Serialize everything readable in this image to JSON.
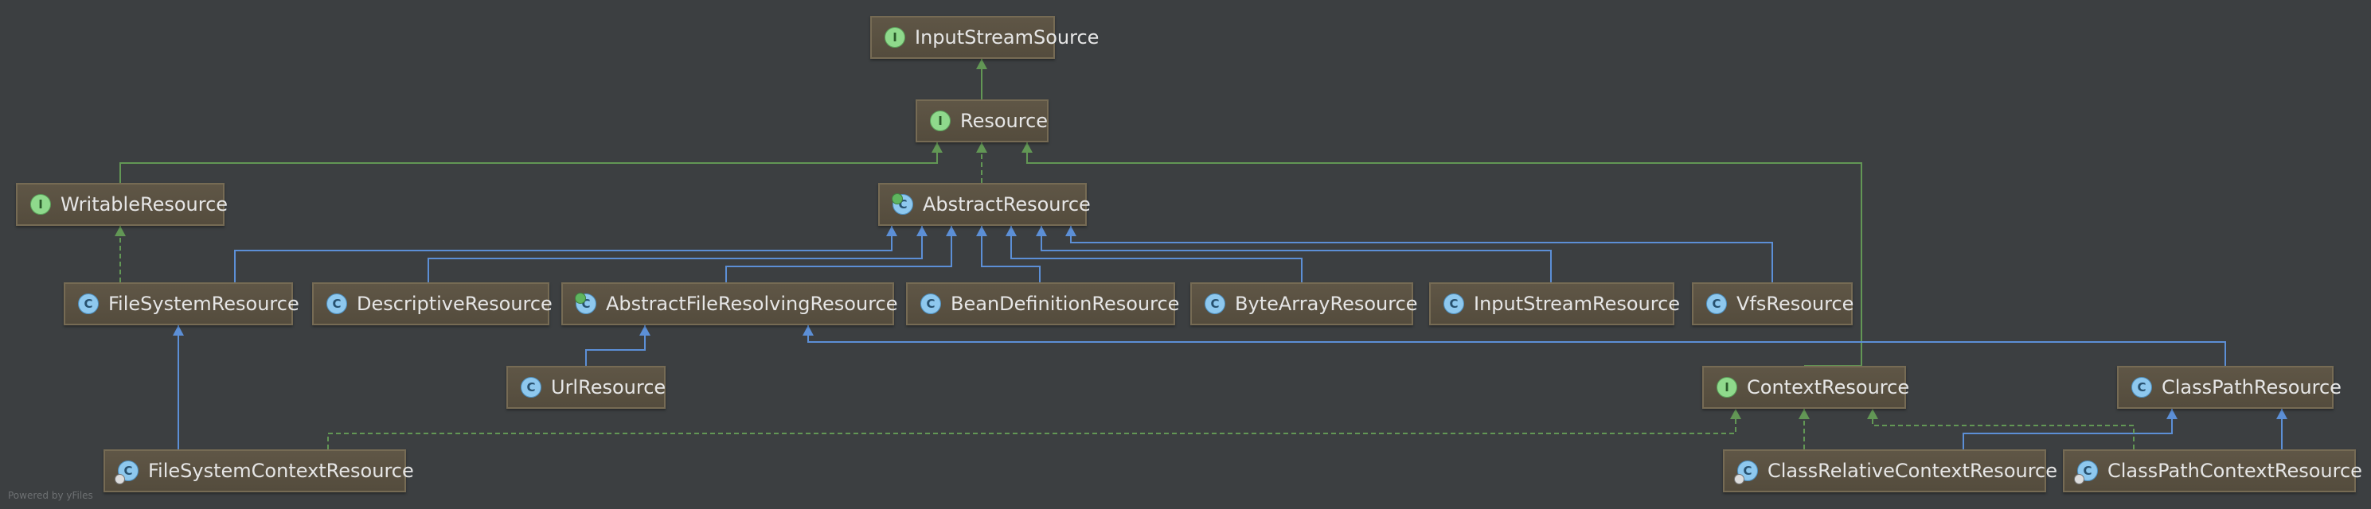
{
  "diagram": {
    "nodes": [
      {
        "id": "InputStreamSource",
        "label": "InputStreamSource",
        "kind": "interface",
        "badge": "I"
      },
      {
        "id": "Resource",
        "label": "Resource",
        "kind": "interface",
        "badge": "I"
      },
      {
        "id": "WritableResource",
        "label": "WritableResource",
        "kind": "interface",
        "badge": "I"
      },
      {
        "id": "AbstractResource",
        "label": "AbstractResource",
        "kind": "abstract",
        "badge": "C"
      },
      {
        "id": "FileSystemResource",
        "label": "FileSystemResource",
        "kind": "class",
        "badge": "C"
      },
      {
        "id": "DescriptiveResource",
        "label": "DescriptiveResource",
        "kind": "class",
        "badge": "C"
      },
      {
        "id": "AbstractFileResolvingResource",
        "label": "AbstractFileResolvingResource",
        "kind": "abstract",
        "badge": "C"
      },
      {
        "id": "BeanDefinitionResource",
        "label": "BeanDefinitionResource",
        "kind": "class",
        "badge": "C"
      },
      {
        "id": "ByteArrayResource",
        "label": "ByteArrayResource",
        "kind": "class",
        "badge": "C"
      },
      {
        "id": "InputStreamResource",
        "label": "InputStreamResource",
        "kind": "class",
        "badge": "C"
      },
      {
        "id": "VfsResource",
        "label": "VfsResource",
        "kind": "class",
        "badge": "C"
      },
      {
        "id": "UrlResource",
        "label": "UrlResource",
        "kind": "class",
        "badge": "C"
      },
      {
        "id": "ContextResource",
        "label": "ContextResource",
        "kind": "interface",
        "badge": "I"
      },
      {
        "id": "ClassPathResource",
        "label": "ClassPathResource",
        "kind": "class",
        "badge": "C"
      },
      {
        "id": "FileSystemContextResource",
        "label": "FileSystemContextResource",
        "kind": "class",
        "badge": "C",
        "pinned": true
      },
      {
        "id": "ClassRelativeContextResource",
        "label": "ClassRelativeContextResource",
        "kind": "class",
        "badge": "C",
        "pinned": true
      },
      {
        "id": "ClassPathContextResource",
        "label": "ClassPathContextResource",
        "kind": "class",
        "badge": "C",
        "pinned": true
      }
    ],
    "edges": [
      {
        "from": "Resource",
        "to": "InputStreamSource",
        "type": "extends-interface"
      },
      {
        "from": "WritableResource",
        "to": "Resource",
        "type": "extends-interface"
      },
      {
        "from": "AbstractResource",
        "to": "Resource",
        "type": "implements"
      },
      {
        "from": "ContextResource",
        "to": "Resource",
        "type": "extends-interface"
      },
      {
        "from": "FileSystemResource",
        "to": "WritableResource",
        "type": "implements"
      },
      {
        "from": "FileSystemResource",
        "to": "AbstractResource",
        "type": "extends"
      },
      {
        "from": "DescriptiveResource",
        "to": "AbstractResource",
        "type": "extends"
      },
      {
        "from": "AbstractFileResolvingResource",
        "to": "AbstractResource",
        "type": "extends"
      },
      {
        "from": "BeanDefinitionResource",
        "to": "AbstractResource",
        "type": "extends"
      },
      {
        "from": "ByteArrayResource",
        "to": "AbstractResource",
        "type": "extends"
      },
      {
        "from": "InputStreamResource",
        "to": "AbstractResource",
        "type": "extends"
      },
      {
        "from": "VfsResource",
        "to": "AbstractResource",
        "type": "extends"
      },
      {
        "from": "UrlResource",
        "to": "AbstractFileResolvingResource",
        "type": "extends"
      },
      {
        "from": "ClassPathResource",
        "to": "AbstractFileResolvingResource",
        "type": "extends"
      },
      {
        "from": "FileSystemContextResource",
        "to": "FileSystemResource",
        "type": "extends"
      },
      {
        "from": "FileSystemContextResource",
        "to": "ContextResource",
        "type": "implements"
      },
      {
        "from": "ClassRelativeContextResource",
        "to": "ContextResource",
        "type": "implements"
      },
      {
        "from": "ClassRelativeContextResource",
        "to": "ClassPathResource",
        "type": "extends"
      },
      {
        "from": "ClassPathContextResource",
        "to": "ContextResource",
        "type": "implements"
      },
      {
        "from": "ClassPathContextResource",
        "to": "ClassPathResource",
        "type": "extends"
      }
    ]
  },
  "watermark": "Powered by yFiles",
  "colors": {
    "background": "#3c3f41",
    "edge_green": "#629755",
    "edge_blue": "#5c8fd6",
    "node_fill": "#5a5242",
    "node_border": "#766b54",
    "node_text": "#e6e6e6"
  }
}
